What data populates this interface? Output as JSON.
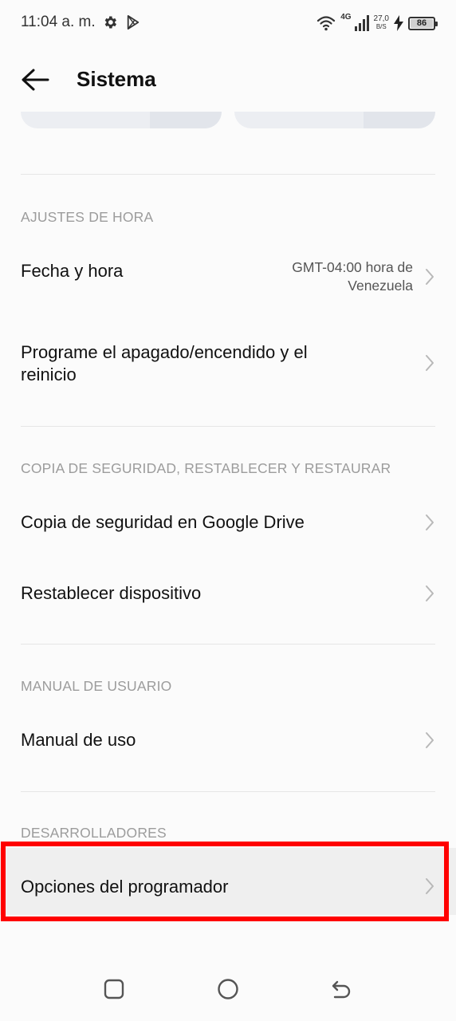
{
  "status_bar": {
    "time": "11:04 a. m.",
    "network_type": "4G",
    "data_rate_value": "27,0",
    "data_rate_unit": "B/S",
    "battery_level": "86",
    "icons": [
      "gear-icon",
      "play-store-icon",
      "wifi-icon",
      "signal-icon",
      "charging-bolt-icon",
      "battery-icon"
    ]
  },
  "header": {
    "title": "Sistema",
    "back_icon": "arrow-left-icon"
  },
  "sections": [
    {
      "header": "AJUSTES DE HORA",
      "items": [
        {
          "title": "Fecha y hora",
          "value_line1": "GMT-04:00 hora de",
          "value_line2": "Venezuela"
        },
        {
          "title_line1": "Programe el apagado/encendido y el",
          "title_line2": "reinicio"
        }
      ]
    },
    {
      "header": "COPIA DE SEGURIDAD, RESTABLECER Y RESTAURAR",
      "items": [
        {
          "title": "Copia de seguridad en Google Drive"
        },
        {
          "title": "Restablecer dispositivo"
        }
      ]
    },
    {
      "header": "MANUAL DE USUARIO",
      "items": [
        {
          "title": "Manual de uso"
        }
      ]
    },
    {
      "header": "DESARROLLADORES",
      "items": [
        {
          "title": "Opciones del programador"
        }
      ]
    }
  ],
  "highlight_color": "#ff0000",
  "nav_bar": {
    "icons": [
      "recents-square-icon",
      "home-circle-icon",
      "back-return-icon"
    ]
  }
}
